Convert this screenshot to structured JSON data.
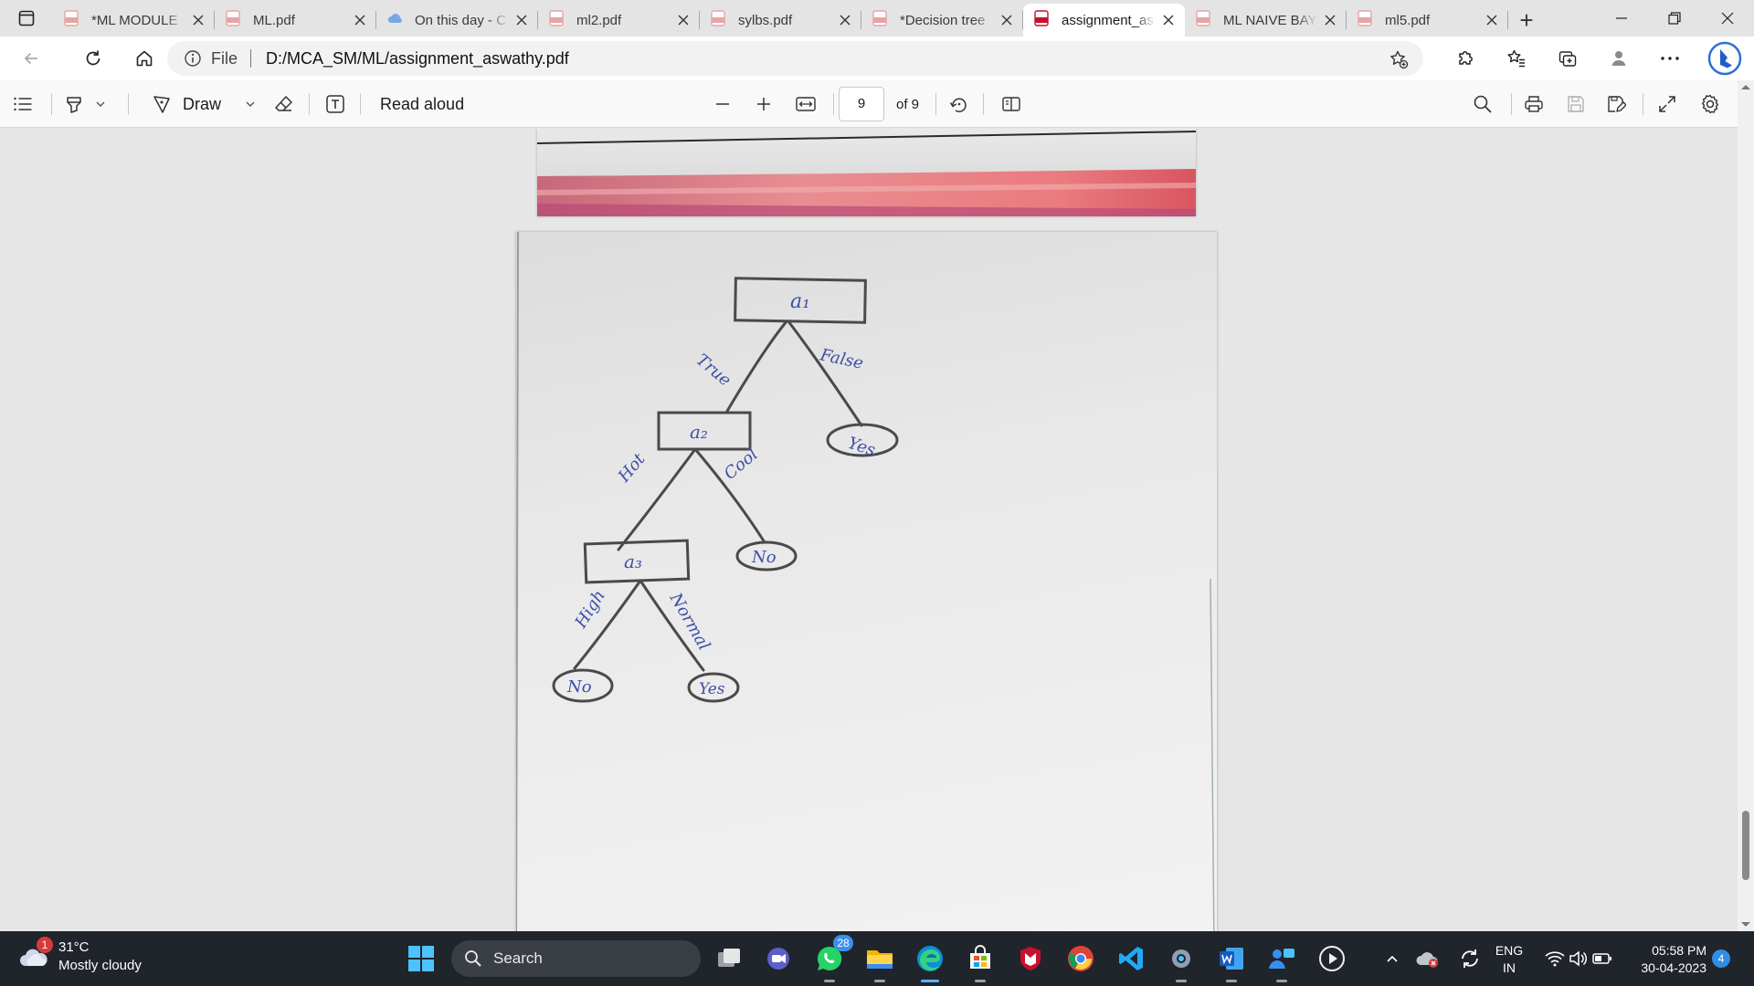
{
  "browser": {
    "tabs": [
      {
        "title": "*ML MODULE",
        "icon": "pdf-icon",
        "active": false
      },
      {
        "title": "ML.pdf",
        "icon": "pdf-icon",
        "active": false
      },
      {
        "title": "On this day - C",
        "icon": "cloud-icon",
        "active": false
      },
      {
        "title": "ml2.pdf",
        "icon": "pdf-icon",
        "active": false
      },
      {
        "title": "sylbs.pdf",
        "icon": "pdf-icon",
        "active": false
      },
      {
        "title": "*Decision tree",
        "icon": "pdf-icon",
        "active": false
      },
      {
        "title": "assignment_as",
        "icon": "pdf-icon",
        "active": true
      },
      {
        "title": "ML NAIVE BAY",
        "icon": "pdf-icon",
        "active": false
      },
      {
        "title": "ml5.pdf",
        "icon": "pdf-icon",
        "active": false
      }
    ],
    "new_tab": "+",
    "address": {
      "scheme_label": "File",
      "url": "D:/MCA_SM/ML/assignment_aswathy.pdf"
    }
  },
  "pdf_toolbar": {
    "draw_label": "Draw",
    "read_aloud_label": "Read aloud",
    "page_current": "9",
    "page_total": "of 9"
  },
  "document": {
    "tree": {
      "root": "a₁",
      "edge_true": "True",
      "edge_false": "False",
      "leaf_false": "Yes",
      "node2": "a₂",
      "edge_hot": "Hot",
      "edge_cool": "Cool",
      "leaf_cool": "No",
      "node3": "a₃",
      "edge_high": "High",
      "edge_normal": "Normal",
      "leaf_high": "No",
      "leaf_normal": "Yes"
    }
  },
  "taskbar": {
    "weather": {
      "temp": "31°C",
      "condition": "Mostly cloudy",
      "badge": "1"
    },
    "search_label": "Search",
    "whatsapp_badge": "28",
    "language": {
      "line1": "ENG",
      "line2": "IN"
    },
    "clock": {
      "time": "05:58 PM",
      "date": "30-04-2023"
    },
    "notifications": "4"
  }
}
